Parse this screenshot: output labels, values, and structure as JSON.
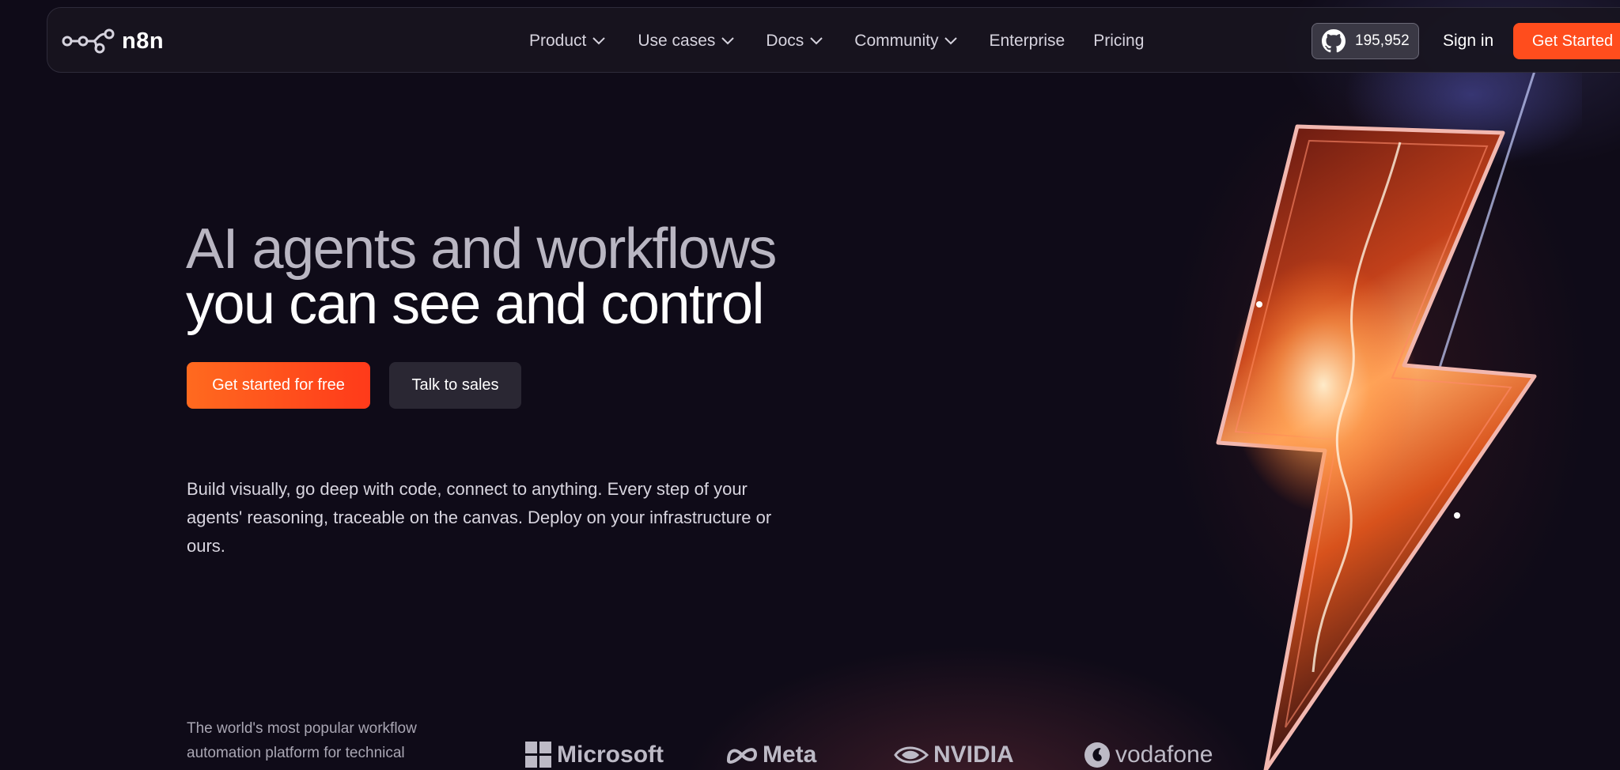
{
  "brand": {
    "logo_text": "n8n"
  },
  "nav": {
    "items": [
      {
        "label": "Product",
        "has_dropdown": true
      },
      {
        "label": "Use cases",
        "has_dropdown": true
      },
      {
        "label": "Docs",
        "has_dropdown": true
      },
      {
        "label": "Community",
        "has_dropdown": true
      },
      {
        "label": "Enterprise",
        "has_dropdown": false
      },
      {
        "label": "Pricing",
        "has_dropdown": false
      }
    ],
    "github_stars": "195,952",
    "sign_in_label": "Sign in",
    "get_started_label": "Get Started"
  },
  "hero": {
    "title_line1": "AI agents and workflows",
    "title_line2": "you can see and control",
    "primary_cta": "Get started for free",
    "secondary_cta": "Talk to sales",
    "description": "Build visually, go deep with code, connect to anything. Every step of your agents' reasoning, traceable on the canvas. Deploy on your infrastructure or ours."
  },
  "social_proof": {
    "tagline": "The world's most popular workflow automation platform for technical",
    "logos": [
      {
        "name": "Microsoft",
        "icon": "microsoft-logo-icon"
      },
      {
        "name": "Meta",
        "icon": "meta-logo-icon"
      },
      {
        "name": "NVIDIA",
        "icon": "nvidia-logo-icon"
      },
      {
        "name": "vodafone",
        "icon": "vodafone-logo-icon"
      }
    ]
  },
  "colors": {
    "background": "#0f0b18",
    "accent": "#ff4d1d",
    "nav_background": "#181520",
    "secondary_button": "#2a2733"
  }
}
